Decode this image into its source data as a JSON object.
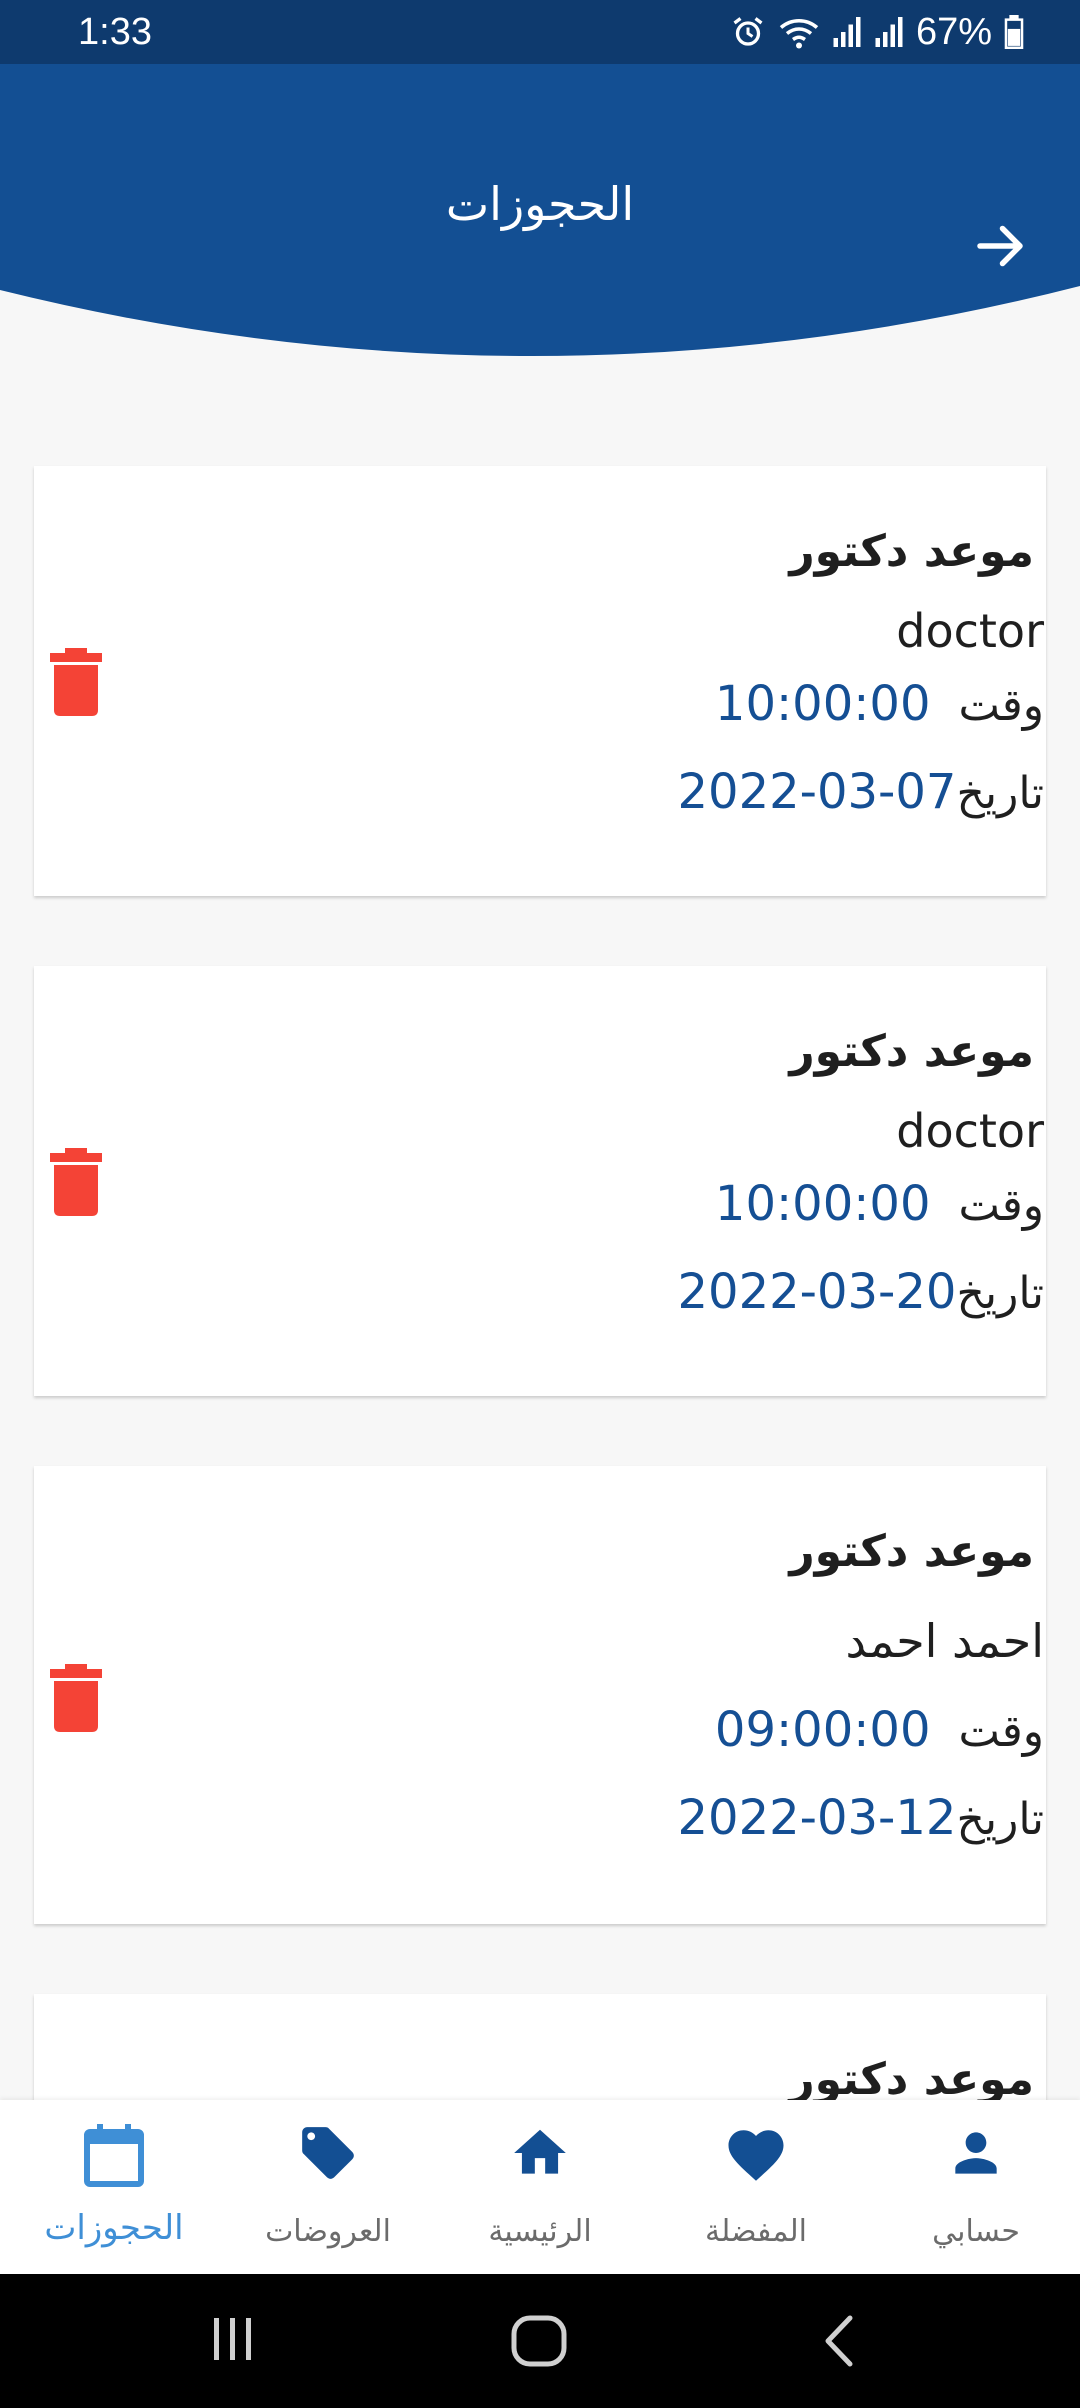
{
  "status_bar": {
    "time": "1:33",
    "battery": "67%",
    "icons": [
      "alarm-icon",
      "wifi-icon",
      "signal-icon",
      "signal-icon",
      "battery-icon"
    ]
  },
  "header": {
    "title": "الحجوزات",
    "back_icon": "arrow-right-icon",
    "color": "#134f93"
  },
  "bookings": [
    {
      "title": "موعد دكتور",
      "name": "doctor",
      "time_label": "وقت",
      "time": "10:00:00",
      "date_label": "تاريخ",
      "date": "2022-03-07"
    },
    {
      "title": "موعد دكتور",
      "name": "doctor",
      "time_label": "وقت",
      "time": "10:00:00",
      "date_label": "تاريخ",
      "date": "2022-03-20"
    },
    {
      "title": "موعد دكتور",
      "name": "احمد احمد",
      "time_label": "وقت",
      "time": "09:00:00",
      "date_label": "تاريخ",
      "date": "2022-03-12"
    },
    {
      "title": "موعد دكتور"
    }
  ],
  "bottom_nav": {
    "items": [
      {
        "label": "الحجوزات",
        "icon": "calendar-icon",
        "active": true
      },
      {
        "label": "العروضات",
        "icon": "tag-icon",
        "active": false
      },
      {
        "label": "الرئيسية",
        "icon": "home-icon",
        "active": false
      },
      {
        "label": "المفضلة",
        "icon": "heart-icon",
        "active": false
      },
      {
        "label": "حسابي",
        "icon": "person-icon",
        "active": false
      }
    ]
  },
  "colors": {
    "primary": "#134f93",
    "status_bar": "#0e3a6e",
    "value_text": "#154f94",
    "delete": "#f44336",
    "active_nav": "#3f8fd6"
  }
}
